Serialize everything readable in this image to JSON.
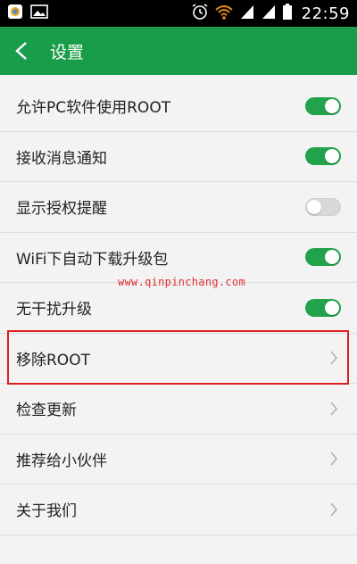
{
  "status_bar": {
    "time": "22:59",
    "left_icons": [
      "app-notification-icon",
      "image-notification-icon"
    ],
    "right_icons": [
      "alarm-icon",
      "wifi-icon",
      "signal-icon",
      "signal-icon",
      "battery-icon"
    ]
  },
  "header": {
    "title": "设置",
    "back_icon": "chevron-left-icon",
    "color": "#1a9d4a"
  },
  "settings": [
    {
      "label": "允许PC软件使用ROOT",
      "control": "toggle",
      "on": true
    },
    {
      "label": "接收消息通知",
      "control": "toggle",
      "on": true
    },
    {
      "label": "显示授权提醒",
      "control": "toggle",
      "on": false
    },
    {
      "label": "WiFi下自动下载升级包",
      "control": "toggle",
      "on": true
    },
    {
      "label": "无干扰升级",
      "control": "toggle",
      "on": true
    },
    {
      "label": "移除ROOT",
      "control": "chevron",
      "highlighted": true
    },
    {
      "label": "检查更新",
      "control": "chevron"
    },
    {
      "label": "推荐给小伙伴",
      "control": "chevron"
    },
    {
      "label": "关于我们",
      "control": "chevron"
    }
  ],
  "watermark": "www.qinpinchang.com",
  "colors": {
    "toggle_on": "#22a34b",
    "toggle_off": "#d8d8d8",
    "highlight": "#e02020"
  }
}
